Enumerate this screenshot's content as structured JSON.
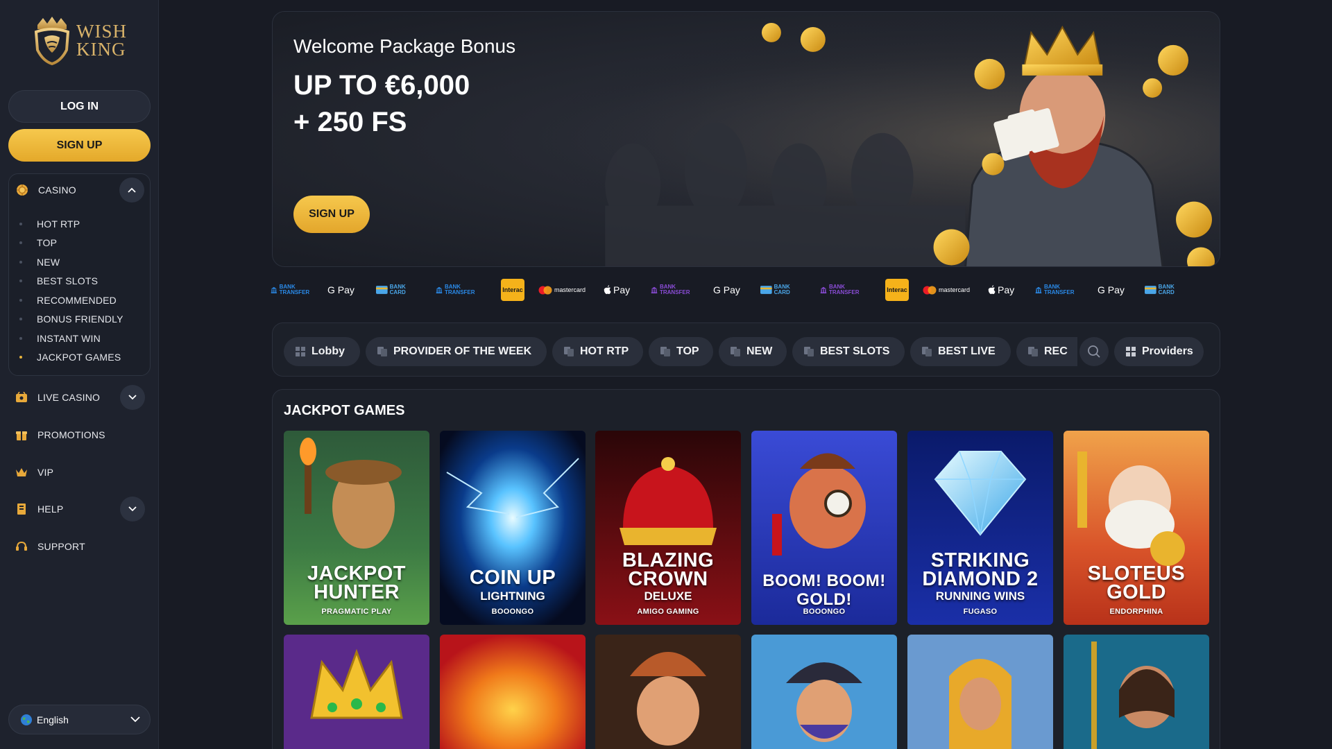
{
  "brand": {
    "name_line1": "WISH",
    "name_line2": "KING"
  },
  "auth": {
    "login_label": "LOG IN",
    "signup_label": "SIGN UP"
  },
  "sidebar": {
    "casino": {
      "label": "CASINO",
      "items": [
        {
          "label": "HOT RTP"
        },
        {
          "label": "TOP"
        },
        {
          "label": "NEW"
        },
        {
          "label": "BEST SLOTS"
        },
        {
          "label": "RECOMMENDED"
        },
        {
          "label": "BONUS FRIENDLY"
        },
        {
          "label": "INSTANT WIN"
        },
        {
          "label": "JACKPOT GAMES"
        }
      ]
    },
    "live_casino": {
      "label": "LIVE CASINO"
    },
    "promotions": {
      "label": "PROMOTIONS"
    },
    "vip": {
      "label": "VIP"
    },
    "help": {
      "label": "HELP"
    },
    "support": {
      "label": "SUPPORT"
    },
    "language": {
      "label": "English"
    }
  },
  "banner": {
    "subtitle": "Welcome Package Bonus",
    "amount": "UP TO €6,000",
    "free_spins": "+ 250 FS",
    "cta": "SIGN UP"
  },
  "payments": [
    {
      "label": "BANK TRANSFER",
      "icon": "bank-transfer-icon"
    },
    {
      "label": "G Pay",
      "icon": "google-pay-icon"
    },
    {
      "label": "BANK CARD",
      "icon": "bank-card-icon"
    },
    {
      "label": "BANK TRANSFER",
      "icon": "bank-transfer-icon"
    },
    {
      "label": "Interac",
      "icon": "interac-icon"
    },
    {
      "label": "mastercard",
      "icon": "mastercard-icon"
    },
    {
      "label": "Pay",
      "icon": "apple-pay-icon"
    },
    {
      "label": "BANK TRANSFER",
      "icon": "bank-transfer-icon"
    },
    {
      "label": "G Pay",
      "icon": "google-pay-icon"
    },
    {
      "label": "BANK CARD",
      "icon": "bank-card-icon"
    },
    {
      "label": "BANK TRANSFER",
      "icon": "bank-transfer-icon"
    },
    {
      "label": "Interac",
      "icon": "interac-icon"
    },
    {
      "label": "mastercard",
      "icon": "mastercard-icon"
    },
    {
      "label": "Pay",
      "icon": "apple-pay-icon"
    },
    {
      "label": "BANK TRANSFER",
      "icon": "bank-transfer-icon"
    },
    {
      "label": "G Pay",
      "icon": "google-pay-icon"
    },
    {
      "label": "BANK CARD",
      "icon": "bank-card-icon"
    }
  ],
  "categories": [
    {
      "label": "Lobby"
    },
    {
      "label": "PROVIDER OF THE WEEK"
    },
    {
      "label": "HOT RTP"
    },
    {
      "label": "TOP"
    },
    {
      "label": "NEW"
    },
    {
      "label": "BEST SLOTS"
    },
    {
      "label": "BEST LIVE"
    },
    {
      "label": "REC"
    }
  ],
  "providers_label": "Providers",
  "section": {
    "title": "JACKPOT GAMES",
    "games": [
      {
        "title_lines": [
          "JACKPOT",
          "HUNTER"
        ],
        "subtitle": "",
        "provider": "PRAGMATIC PLAY"
      },
      {
        "title_lines": [
          "COIN UP"
        ],
        "subtitle": "LIGHTNING",
        "provider": "BOOONGO"
      },
      {
        "title_lines": [
          "BLAZING",
          "CROWN"
        ],
        "subtitle": "DELUXE",
        "provider": "AMIGO GAMING"
      },
      {
        "title_lines": [
          "BOOM! BOOM!",
          "GOLD!"
        ],
        "subtitle": "",
        "provider": "BOOONGO"
      },
      {
        "title_lines": [
          "STRIKING",
          "DIAMOND 2"
        ],
        "subtitle": "RUNNING WINS",
        "provider": "FUGASO"
      },
      {
        "title_lines": [
          "SLOTEUS",
          "GOLD"
        ],
        "subtitle": "",
        "provider": "ENDORPHINA"
      }
    ]
  },
  "colors": {
    "accent_gold": "#f0bb3e",
    "bg": "#181b24",
    "panel": "#1c2029",
    "chip": "#2a2f3b"
  }
}
